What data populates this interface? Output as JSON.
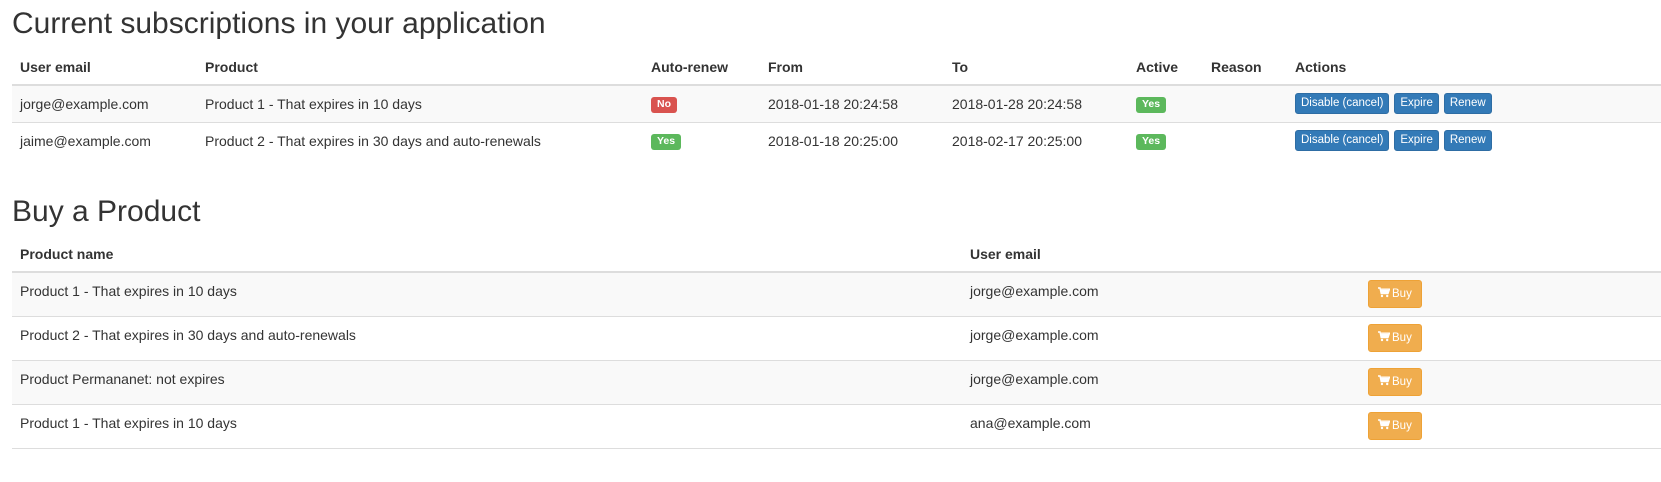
{
  "subscriptions": {
    "title": "Current subscriptions in your application",
    "columns": [
      "User email",
      "Product",
      "Auto-renew",
      "From",
      "To",
      "Active",
      "Reason",
      "Actions"
    ],
    "rows": [
      {
        "email": "jorge@example.com",
        "product": "Product 1 - That expires in 10 days",
        "auto_renew": "No",
        "from": "2018-01-18 20:24:58",
        "to": "2018-01-28 20:24:58",
        "active": "Yes",
        "reason": ""
      },
      {
        "email": "jaime@example.com",
        "product": "Product 2 - That expires in 30 days and auto-renewals",
        "auto_renew": "Yes",
        "from": "2018-01-18 20:25:00",
        "to": "2018-02-17 20:25:00",
        "active": "Yes",
        "reason": ""
      }
    ],
    "actions": {
      "disable": "Disable (cancel)",
      "expire": "Expire",
      "renew": "Renew"
    }
  },
  "buy": {
    "title": "Buy a Product",
    "columns": [
      "Product name",
      "User email",
      ""
    ],
    "rows": [
      {
        "product": "Product 1 - That expires in 10 days",
        "email": "jorge@example.com"
      },
      {
        "product": "Product 2 - That expires in 30 days and auto-renewals",
        "email": "jorge@example.com"
      },
      {
        "product": "Product Permananet: not expires",
        "email": "jorge@example.com"
      },
      {
        "product": "Product 1 - That expires in 10 days",
        "email": "ana@example.com"
      }
    ],
    "buy_label": "Buy",
    "buy_icon": "shopping-cart-icon"
  },
  "colors": {
    "primary": "#337ab7",
    "warning": "#f0ad4e",
    "success": "#5cb85c",
    "danger": "#d9534f"
  }
}
